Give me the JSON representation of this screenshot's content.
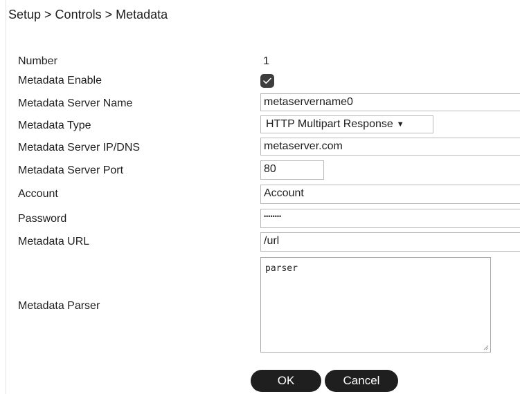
{
  "breadcrumb": "Setup > Controls > Metadata",
  "labels": {
    "number": "Number",
    "enable": "Metadata Enable",
    "server_name": "Metadata Server Name",
    "type": "Metadata Type",
    "server_ip": "Metadata Server IP/DNS",
    "server_port": "Metadata Server Port",
    "account": "Account",
    "password": "Password",
    "url": "Metadata URL",
    "parser": "Metadata Parser"
  },
  "values": {
    "number": "1",
    "enable_checked": true,
    "server_name": "metaservername0",
    "type": "HTTP Multipart Response",
    "server_ip": "metaserver.com",
    "server_port": "80",
    "account": "Account",
    "password_masked": "••••••••",
    "url": "/url",
    "parser": "parser"
  },
  "icons": {
    "checkmark": "check-icon",
    "dropdown": "caret-down-icon",
    "resize": "resize-grip-icon"
  },
  "buttons": {
    "ok": "OK",
    "cancel": "Cancel"
  },
  "colors": {
    "button_bg": "#1f1f1f",
    "checkbox_bg": "#3d3d3d",
    "field_border": "#b9b9b9"
  }
}
